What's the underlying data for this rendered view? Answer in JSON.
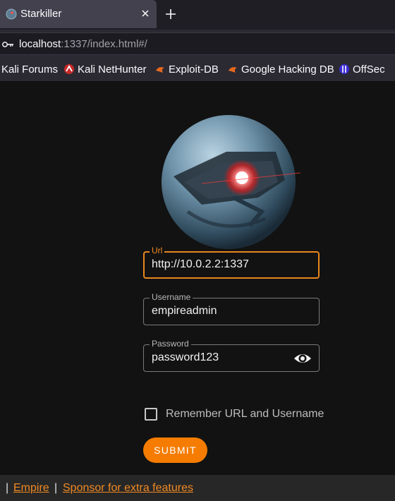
{
  "browser": {
    "tab": {
      "title": "Starkiller"
    },
    "url": {
      "host": "localhost",
      "rest": ":1337/index.html#/"
    },
    "bookmarks": [
      {
        "label": "Kali Forums"
      },
      {
        "label": "Kali NetHunter"
      },
      {
        "label": "Exploit-DB"
      },
      {
        "label": "Google Hacking DB"
      },
      {
        "label": "OffSec"
      }
    ]
  },
  "login": {
    "url": {
      "label": "Url",
      "value": "http://10.0.2.2:1337"
    },
    "username": {
      "label": "Username",
      "value": "empireadmin"
    },
    "password": {
      "label": "Password",
      "value": "password123"
    },
    "remember_label": "Remember URL and Username",
    "remember_checked": false,
    "submit_label": "SUBMIT"
  },
  "footer": {
    "separator": "|",
    "empire_link": "Empire",
    "sponsor_link": "Sponsor for extra features"
  },
  "colors": {
    "accent": "#f57c00",
    "page_bg": "#121212",
    "chrome_bg": "#2b2a33"
  }
}
